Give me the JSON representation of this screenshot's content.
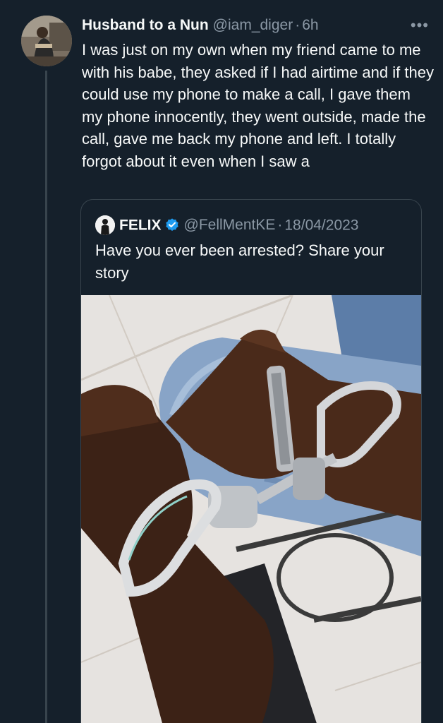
{
  "tweet": {
    "display_name": "Husband to a Nun",
    "handle": "@iam_diger",
    "separator": "·",
    "time": "6h",
    "more_label": "•••",
    "text": "I was just on my own when my friend came to me with his babe, they asked if I had airtime and if they could use my phone to make a call, I gave them my phone innocently, they went outside, made the call, gave me back my phone and left. I totally forgot about it even when I saw a"
  },
  "quote": {
    "display_name": "FELIX",
    "handle": "@FellMentKE",
    "separator": "·",
    "date": "18/04/2023",
    "text": "Have you ever been arrested? Share your story",
    "media_icon": "handcuffed-wrists-photo"
  },
  "colors": {
    "background": "#15202b",
    "text_primary": "#f7f9f9",
    "text_secondary": "#8b98a5",
    "border": "#38444d",
    "verified_blue": "#1d9bf0"
  }
}
